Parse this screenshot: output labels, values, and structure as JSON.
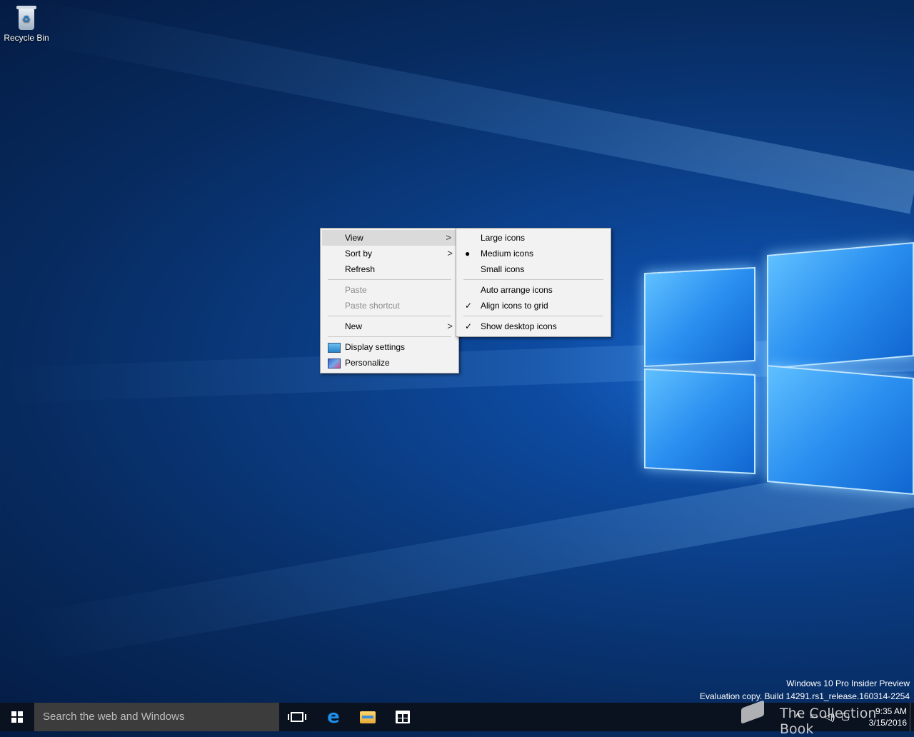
{
  "desktop": {
    "icons": [
      {
        "label": "Recycle Bin",
        "icon": "recycle-bin-icon"
      }
    ],
    "watermark": {
      "line1": "Windows 10 Pro Insider Preview",
      "line2": "Evaluation copy. Build 14291.rs1_release.160314-2254"
    }
  },
  "context_menu": {
    "items": [
      {
        "label": "View",
        "has_submenu": true,
        "highlighted": true
      },
      {
        "label": "Sort by",
        "has_submenu": true
      },
      {
        "label": "Refresh"
      },
      {
        "label": "Paste",
        "disabled": true
      },
      {
        "label": "Paste shortcut",
        "disabled": true
      },
      {
        "label": "New",
        "has_submenu": true
      },
      {
        "label": "Display settings",
        "icon": "display-settings-icon"
      },
      {
        "label": "Personalize",
        "icon": "personalize-icon"
      }
    ],
    "arrow_glyph": ">"
  },
  "view_submenu": {
    "items": [
      {
        "label": "Large icons"
      },
      {
        "label": "Medium icons",
        "mark": "●"
      },
      {
        "label": "Small icons"
      },
      {
        "label": "Auto arrange icons"
      },
      {
        "label": "Align icons to grid",
        "mark": "✓"
      },
      {
        "label": "Show desktop icons",
        "mark": "✓"
      }
    ]
  },
  "taskbar": {
    "search_placeholder": "Search the web and Windows",
    "pinned": [
      "task-view-icon",
      "edge-icon",
      "file-explorer-icon",
      "store-icon"
    ],
    "tray": {
      "chevron": "^",
      "time": "9:35 AM",
      "date": "3/15/2016"
    },
    "overlay_text": "The Collection Book"
  },
  "colors": {
    "taskbar_bg": "#0a1220",
    "search_bg": "#3c3c3c",
    "menu_bg": "#f2f2f2",
    "menu_highlight": "#dadada",
    "accent": "#1d8fe8"
  }
}
